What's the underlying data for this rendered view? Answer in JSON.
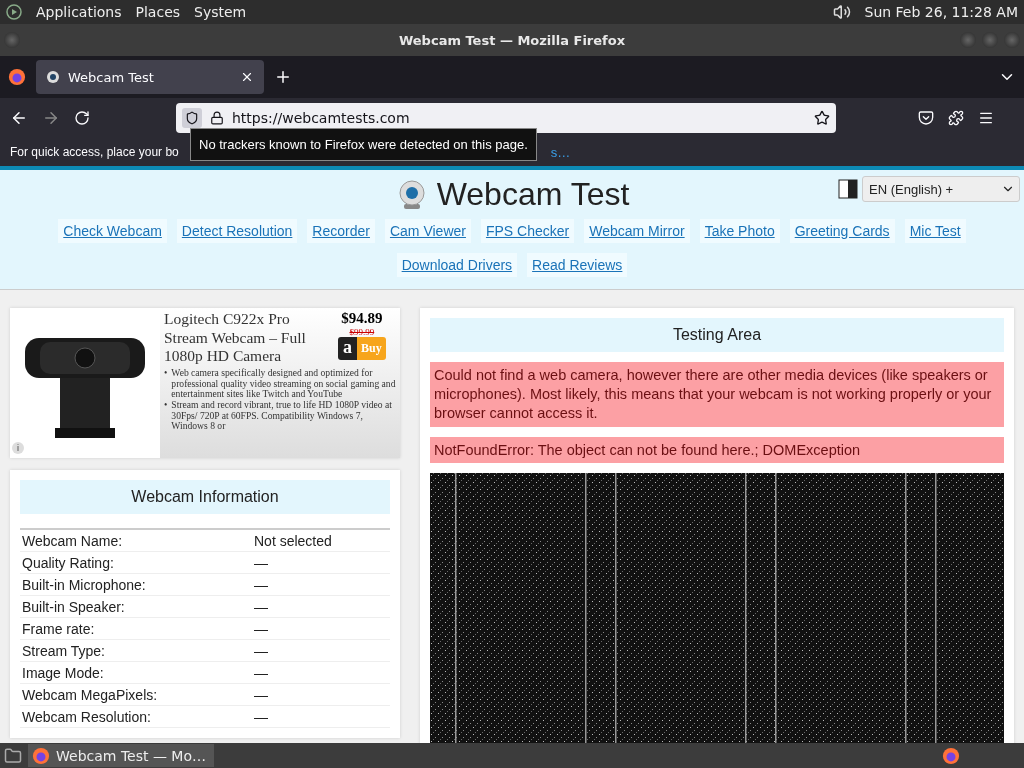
{
  "panel": {
    "menus": [
      "Applications",
      "Places",
      "System"
    ],
    "clock": "Sun Feb 26, 11:28 AM"
  },
  "window": {
    "title": "Webcam Test — Mozilla Firefox"
  },
  "tabs": [
    {
      "label": "Webcam Test",
      "selected": true
    }
  ],
  "address": {
    "url": "https://webcamtests.com"
  },
  "bookmarks_bar": {
    "text": "For quick access, place your bo",
    "link": "s…"
  },
  "tooltip": "No trackers known to Firefox were detected on this page.",
  "site": {
    "title": "Webcam Test",
    "language": "EN (English) +",
    "nav": [
      "Check Webcam",
      "Detect Resolution",
      "Recorder",
      "Cam Viewer",
      "FPS Checker",
      "Webcam Mirror",
      "Take Photo",
      "Greeting Cards",
      "Mic Test",
      "Download Drivers",
      "Read Reviews"
    ]
  },
  "ad": {
    "title": "Logitech C922x Pro Stream Webcam – Full 1080p HD Camera",
    "price": "$94.89",
    "old_price": "$99.99",
    "buy_logo": "a",
    "buy": "Buy",
    "info": "i",
    "bullet_mark": "•",
    "bullets": [
      "Web camera specifically designed and optimized for professional quality video streaming on social gaming and entertainment sites like Twitch and YouTube",
      "Stream and record vibrant, true to life HD 1080P video at 30Fps/ 720P at 60FPS. Compatibility Windows 7, Windows 8 or"
    ]
  },
  "info": {
    "title": "Webcam Information",
    "rows": [
      {
        "label": "Webcam Name:",
        "value": "Not selected"
      },
      {
        "label": "Quality Rating:",
        "value": "—"
      },
      {
        "label": "Built-in Microphone:",
        "value": "—"
      },
      {
        "label": "Built-in Speaker:",
        "value": "—"
      },
      {
        "label": "Frame rate:",
        "value": "—"
      },
      {
        "label": "Stream Type:",
        "value": "—"
      },
      {
        "label": "Image Mode:",
        "value": "—"
      },
      {
        "label": "Webcam MegaPixels:",
        "value": "—"
      },
      {
        "label": "Webcam Resolution:",
        "value": "—"
      }
    ]
  },
  "testing": {
    "title": "Testing Area",
    "errors": [
      "Could not find a web camera, however there are other media devices (like speakers or microphones). Most likely, this means that your webcam is not working properly or your browser cannot access it.",
      "NotFoundError: The object can not be found here.; DOMException"
    ]
  },
  "taskbar": {
    "tasks": [
      {
        "label": "Webcam Test — Mo…",
        "selected": true
      }
    ]
  }
}
